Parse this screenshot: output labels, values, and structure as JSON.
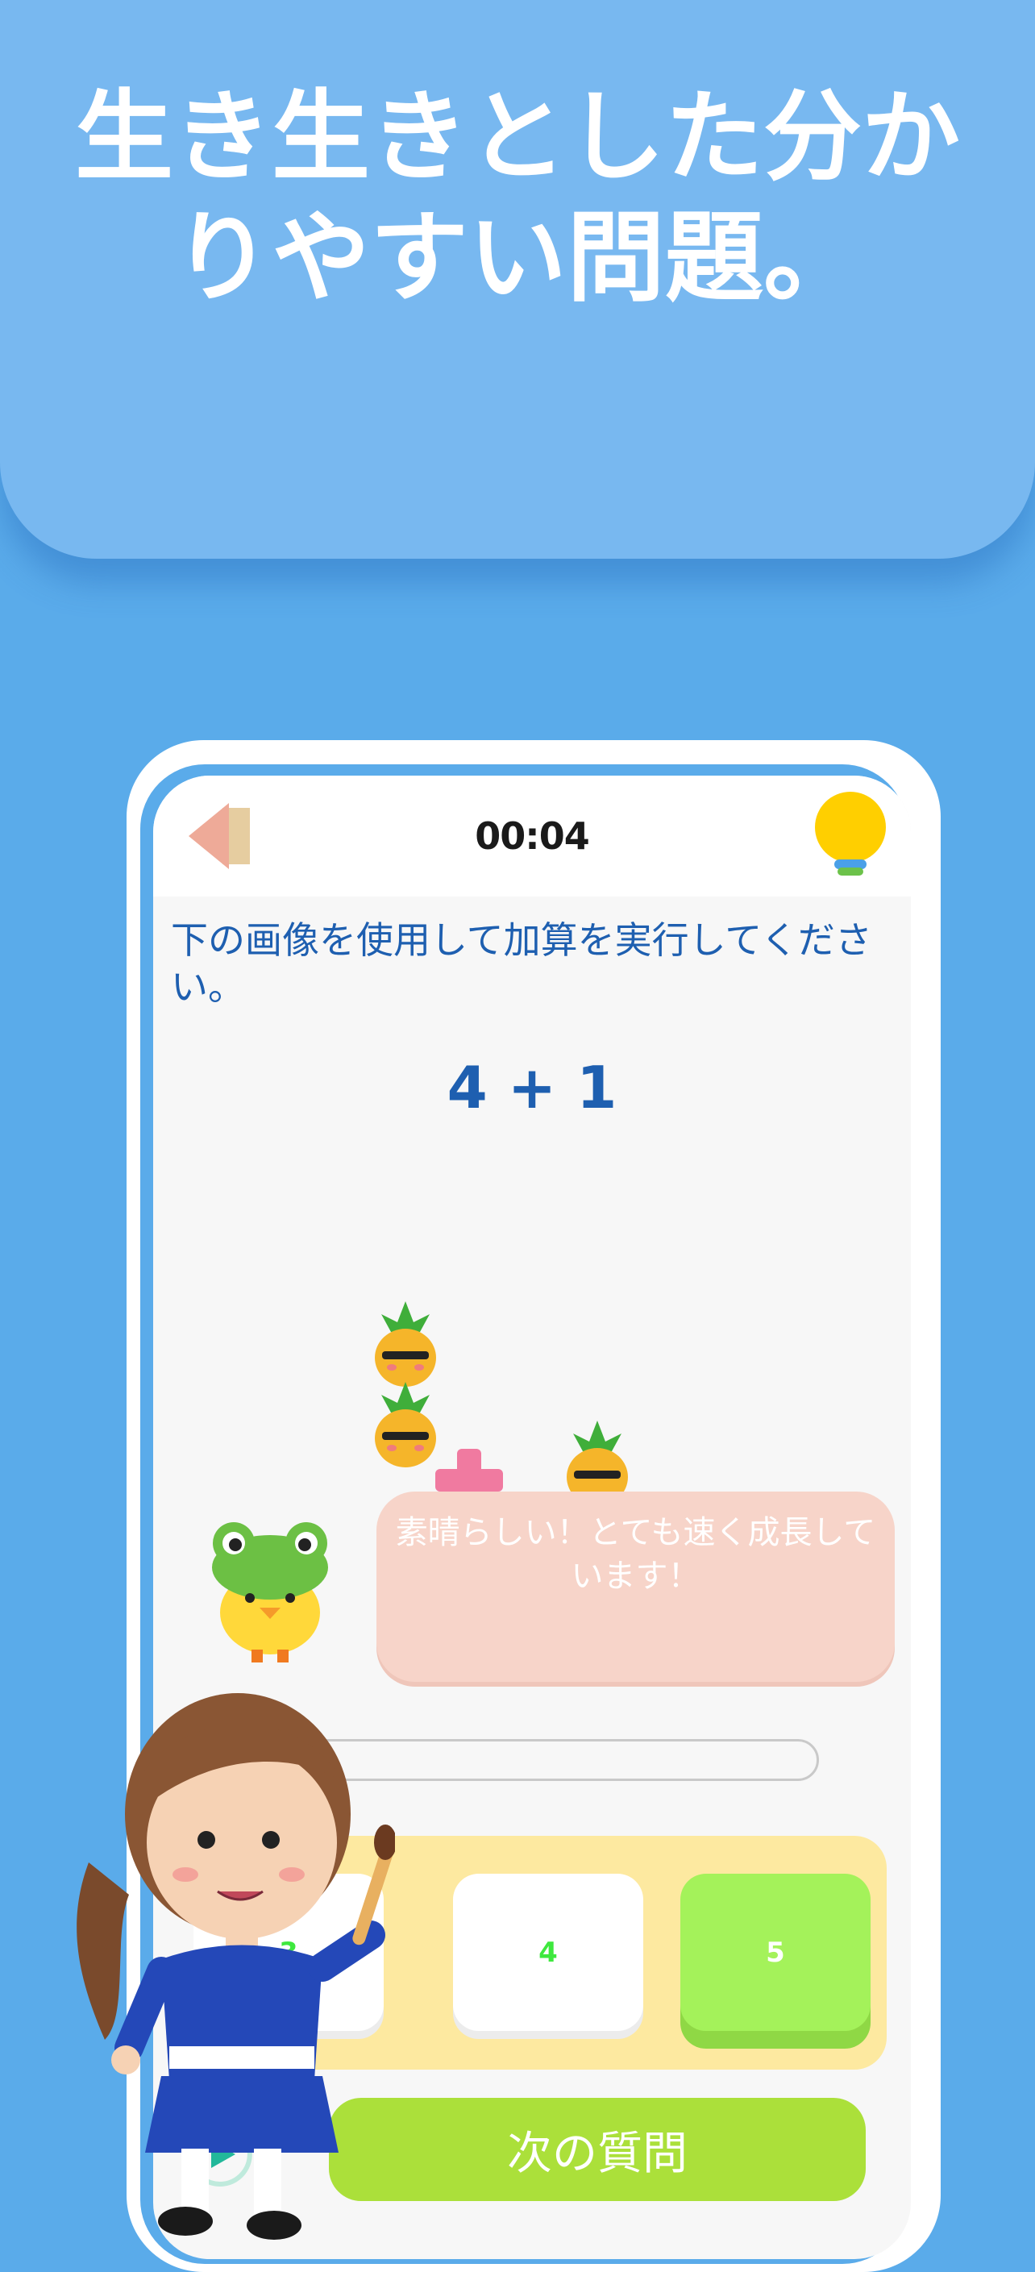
{
  "hero": {
    "headline_line1": "生き生きとした分か",
    "headline_line2": "りやすい問題。"
  },
  "topbar": {
    "back_icon": "back-arrow-icon",
    "timer": "00:04",
    "hint_icon": "lightbulb-icon"
  },
  "question": {
    "text": "下の画像を使用して加算を実行してください。",
    "equation": "4 + 1"
  },
  "feedback": {
    "message": "素晴らしい！とても速く成長しています！"
  },
  "answers": [
    {
      "label": "3",
      "state": "default"
    },
    {
      "label": "4",
      "state": "default"
    },
    {
      "label": "5",
      "state": "selected"
    }
  ],
  "next_button": {
    "label": "次の質問"
  },
  "colors": {
    "background": "#5aabea",
    "hero": "#78b8f0",
    "question_text": "#1e5fb0",
    "next_button": "#abe03a",
    "selected_answer": "#a4f25a",
    "answer_panel": "#fde9a0",
    "speech_bubble": "#f7d4c9"
  }
}
